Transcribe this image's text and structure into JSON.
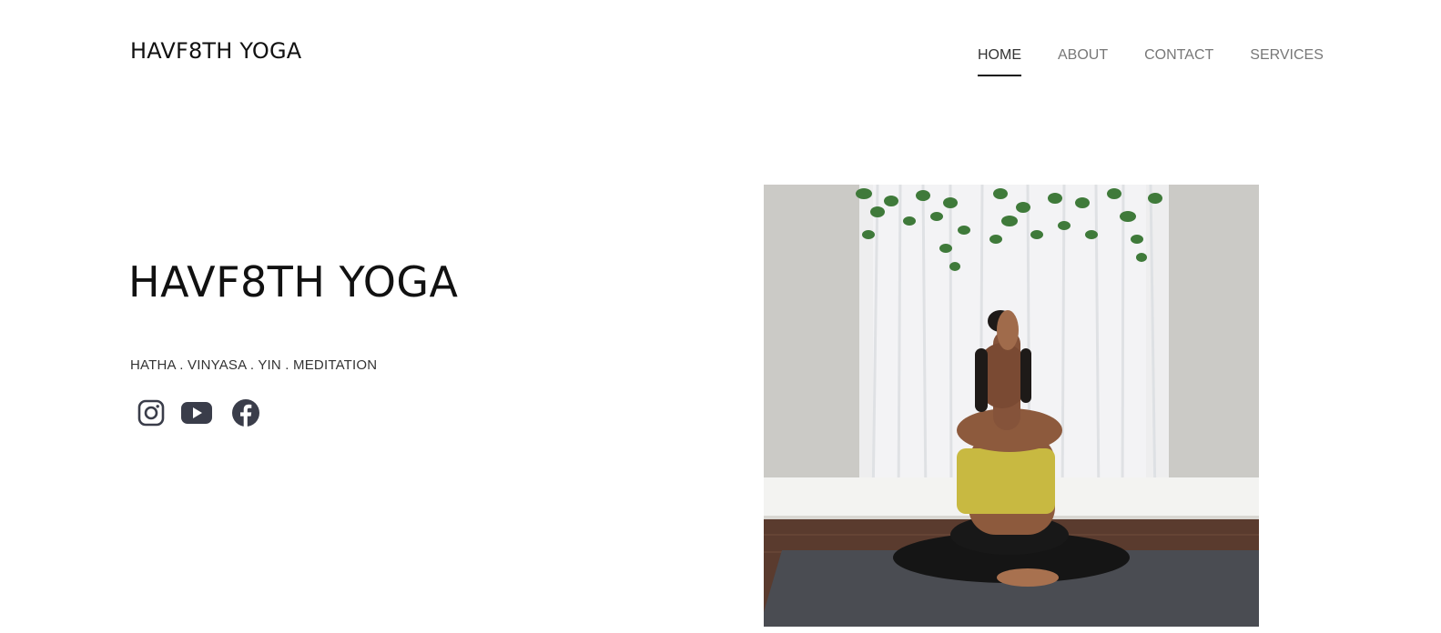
{
  "header": {
    "brand": "HAVF8TH YOGA"
  },
  "nav": {
    "items": [
      {
        "label": "HOME",
        "active": true
      },
      {
        "label": "ABOUT",
        "active": false
      },
      {
        "label": "CONTACT",
        "active": false
      },
      {
        "label": "SERVICES",
        "active": false
      }
    ]
  },
  "hero": {
    "title": "HAVF8TH YOGA",
    "subtitle": "HATHA . VINYASA . YIN . MEDITATION",
    "social": [
      {
        "icon": "instagram-icon"
      },
      {
        "icon": "youtube-icon"
      },
      {
        "icon": "facebook-icon"
      }
    ]
  },
  "colors": {
    "text": "#111111",
    "nav_inactive": "#777777",
    "icon": "#3a3d4a"
  }
}
